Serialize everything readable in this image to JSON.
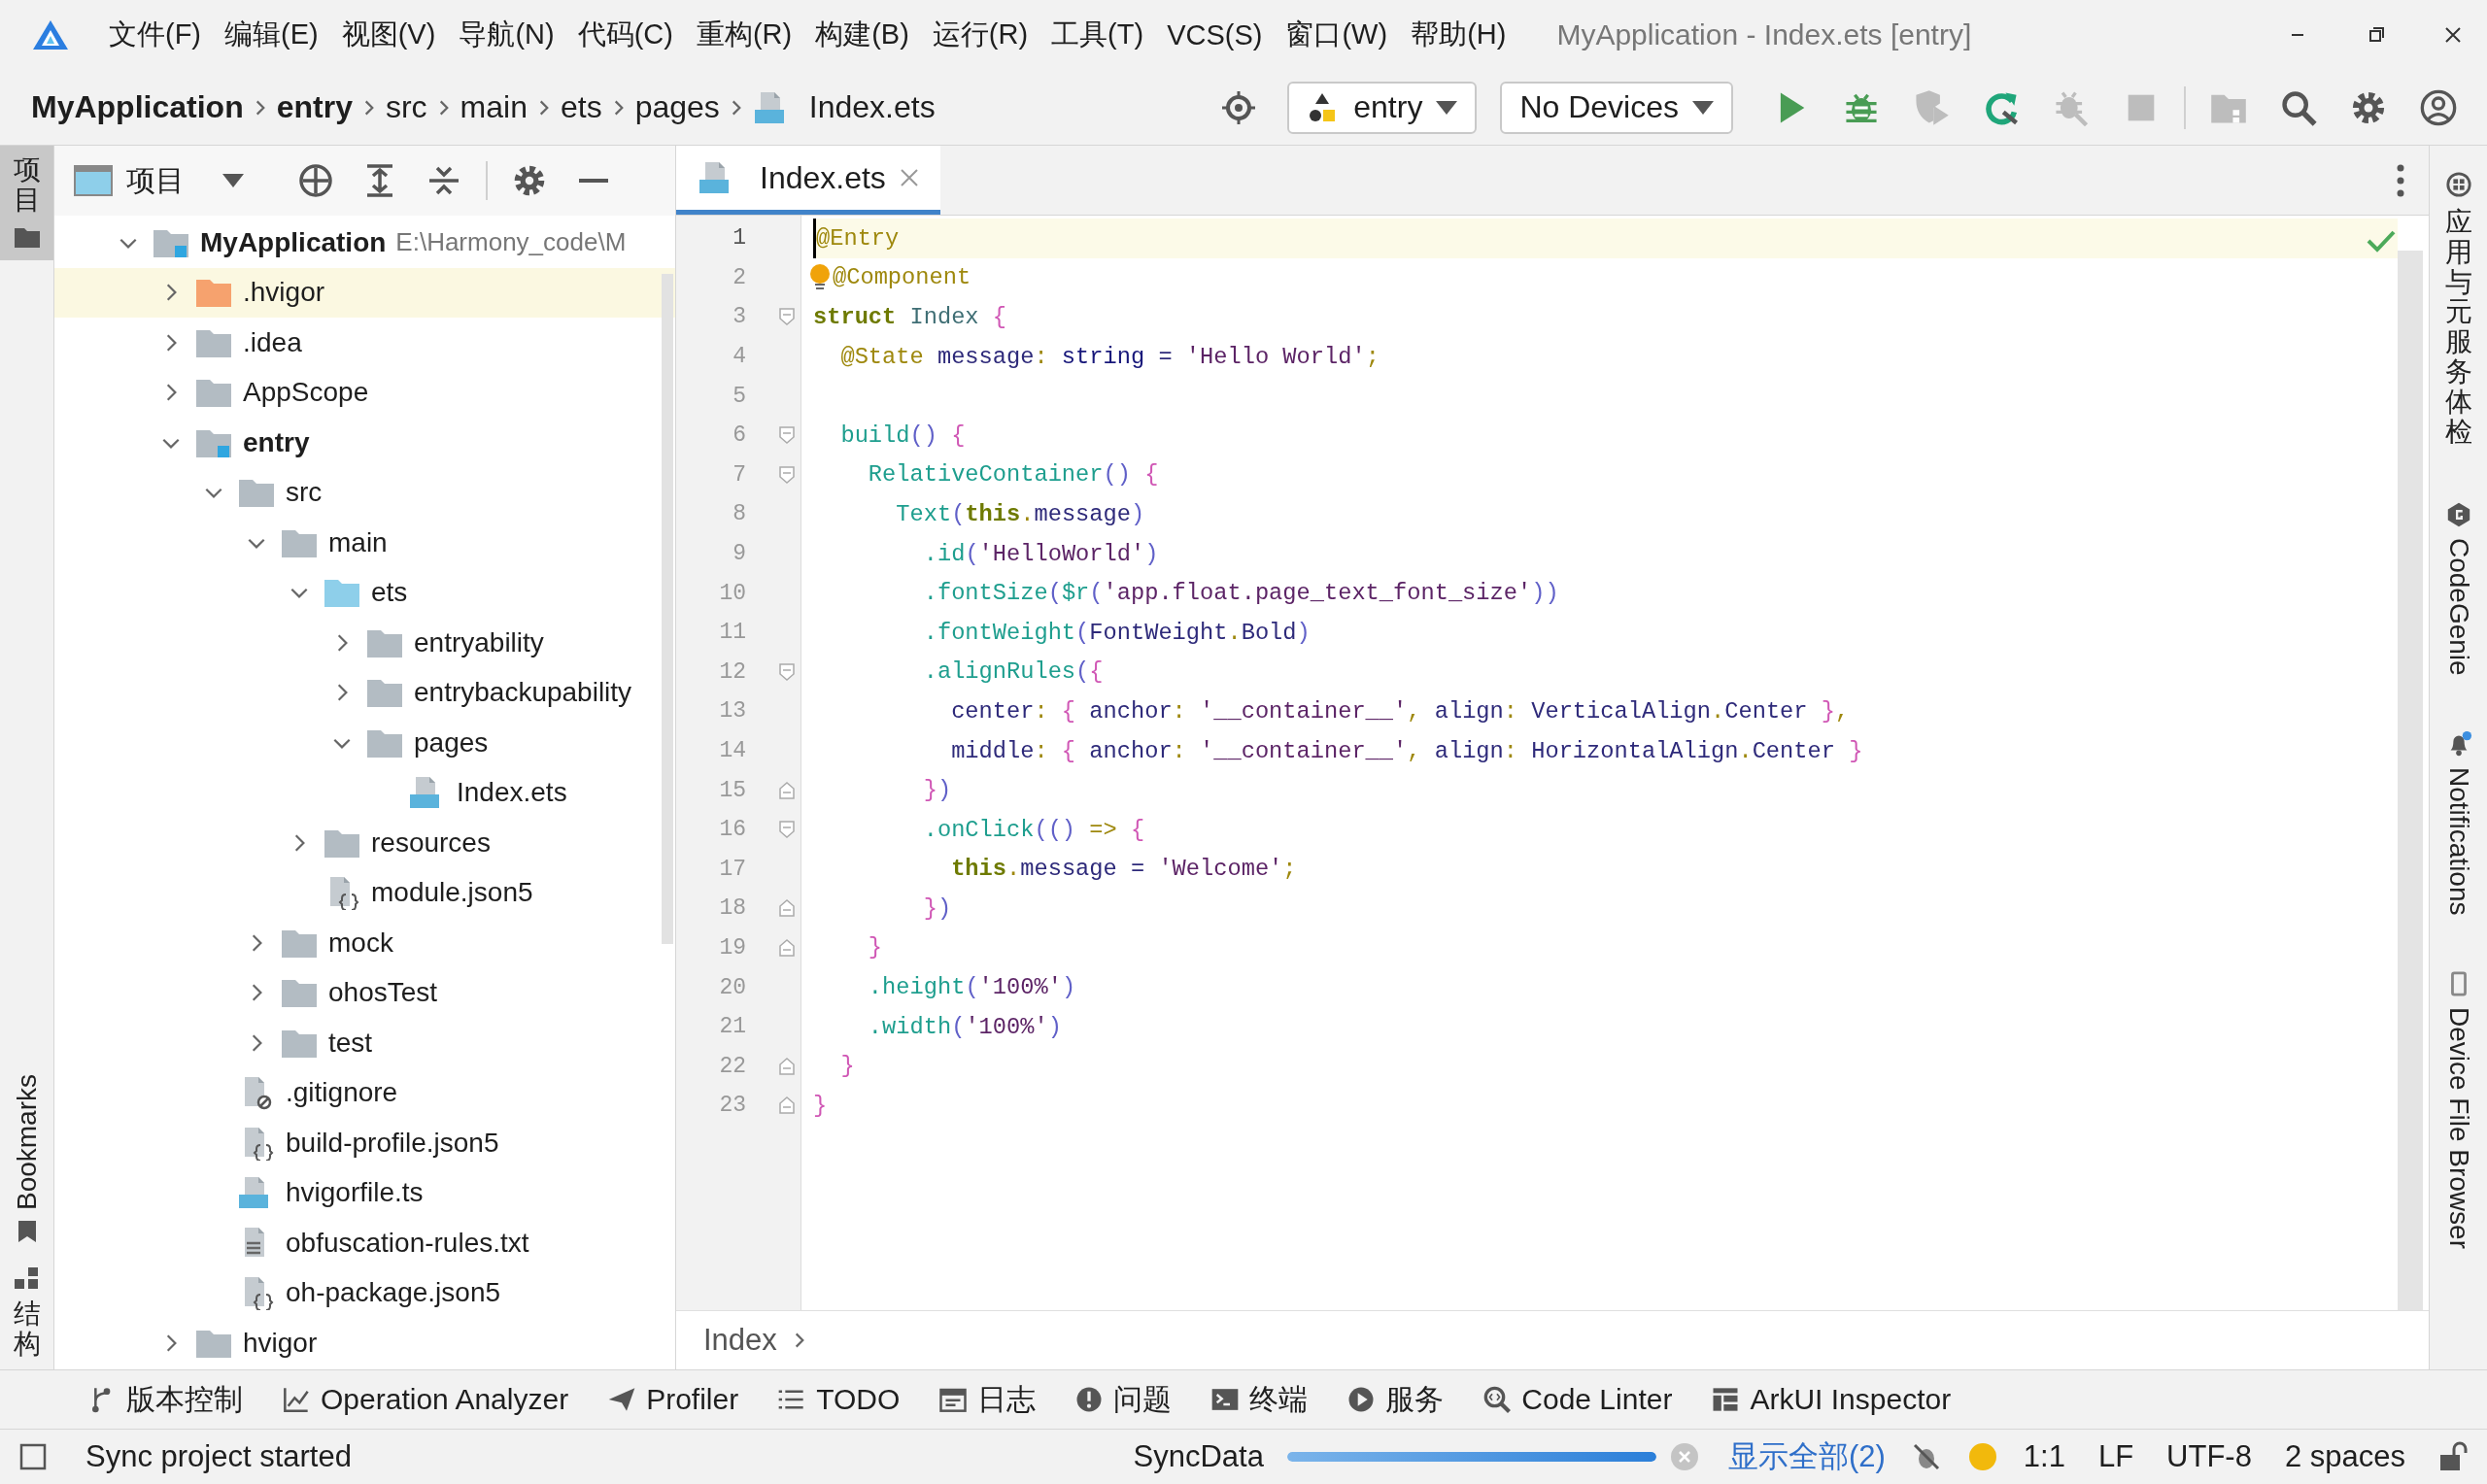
{
  "window": {
    "title": "MyApplication - Index.ets [entry]"
  },
  "menu": [
    "文件(F)",
    "编辑(E)",
    "视图(V)",
    "导航(N)",
    "代码(C)",
    "重构(R)",
    "构建(B)",
    "运行(R)",
    "工具(T)",
    "VCS(S)",
    "窗口(W)",
    "帮助(H)"
  ],
  "breadcrumb": [
    {
      "label": "MyApplication",
      "bold": true,
      "kind": "folder"
    },
    {
      "label": "entry",
      "bold": true,
      "kind": "folder"
    },
    {
      "label": "src",
      "bold": false,
      "kind": "folder"
    },
    {
      "label": "main",
      "bold": false,
      "kind": "folder"
    },
    {
      "label": "ets",
      "bold": false,
      "kind": "folder"
    },
    {
      "label": "pages",
      "bold": false,
      "kind": "folder"
    },
    {
      "label": "Index.ets",
      "bold": false,
      "kind": "ets-file"
    }
  ],
  "run_config": {
    "label": "entry"
  },
  "device": {
    "label": "No Devices"
  },
  "toolbar": [
    {
      "kind": "run",
      "disabled": false
    },
    {
      "kind": "debug",
      "disabled": false
    },
    {
      "kind": "profile",
      "disabled": true
    },
    {
      "kind": "apply",
      "disabled": false
    },
    {
      "kind": "attach",
      "disabled": true
    },
    {
      "kind": "stop",
      "disabled": true
    },
    {
      "kind": "divider"
    },
    {
      "kind": "device-manager",
      "disabled": true
    },
    {
      "kind": "search",
      "disabled": false
    },
    {
      "kind": "settings",
      "disabled": false
    },
    {
      "kind": "account",
      "disabled": false
    }
  ],
  "left_tabs": [
    {
      "label": "项目",
      "kind": "project",
      "selected": true
    },
    {
      "label": "Bookmarks",
      "kind": "bookmarks",
      "selected": false
    },
    {
      "label": "结构",
      "kind": "structure",
      "selected": false
    }
  ],
  "project_panel": {
    "view": "项目",
    "tree": [
      {
        "label": "MyApplication",
        "path": "E:\\Harmony_code\\M",
        "kind": "module",
        "bold": true,
        "highlighted": false,
        "expanded": true,
        "children": [
          {
            "label": ".hvigor",
            "kind": "excluded",
            "bold": false,
            "highlighted": true,
            "expanded": false
          },
          {
            "label": ".idea",
            "kind": "folder",
            "bold": false,
            "highlighted": false,
            "expanded": false
          },
          {
            "label": "AppScope",
            "kind": "folder",
            "bold": false,
            "highlighted": false,
            "expanded": false
          },
          {
            "label": "entry",
            "kind": "module",
            "bold": true,
            "highlighted": false,
            "expanded": true,
            "children": [
              {
                "label": "src",
                "kind": "folder",
                "bold": false,
                "highlighted": false,
                "expanded": true,
                "children": [
                  {
                    "label": "main",
                    "kind": "folder",
                    "bold": false,
                    "highlighted": false,
                    "expanded": true,
                    "children": [
                      {
                        "label": "ets",
                        "kind": "source",
                        "bold": false,
                        "highlighted": false,
                        "expanded": true,
                        "children": [
                          {
                            "label": "entryability",
                            "kind": "folder",
                            "bold": false,
                            "highlighted": false,
                            "expanded": false
                          },
                          {
                            "label": "entrybackupability",
                            "kind": "folder",
                            "bold": false,
                            "highlighted": false,
                            "expanded": false
                          },
                          {
                            "label": "pages",
                            "kind": "folder",
                            "bold": false,
                            "highlighted": false,
                            "expanded": true,
                            "children": [
                              {
                                "label": "Index.ets",
                                "kind": "ets-file",
                                "bold": false,
                                "highlighted": false
                              }
                            ]
                          }
                        ]
                      },
                      {
                        "label": "resources",
                        "kind": "folder",
                        "bold": false,
                        "highlighted": false,
                        "expanded": false
                      },
                      {
                        "label": "module.json5",
                        "kind": "json-file",
                        "bold": false,
                        "highlighted": false
                      }
                    ]
                  },
                  {
                    "label": "mock",
                    "kind": "folder",
                    "bold": false,
                    "highlighted": false,
                    "expanded": false
                  },
                  {
                    "label": "ohosTest",
                    "kind": "folder",
                    "bold": false,
                    "highlighted": false,
                    "expanded": false
                  },
                  {
                    "label": "test",
                    "kind": "folder",
                    "bold": false,
                    "highlighted": false,
                    "expanded": false
                  }
                ]
              },
              {
                "label": ".gitignore",
                "kind": "ignore-file",
                "bold": false,
                "highlighted": false
              },
              {
                "label": "build-profile.json5",
                "kind": "json-file",
                "bold": false,
                "highlighted": false
              },
              {
                "label": "hvigorfile.ts",
                "kind": "ts-file",
                "bold": false,
                "highlighted": false
              },
              {
                "label": "obfuscation-rules.txt",
                "kind": "text-file",
                "bold": false,
                "highlighted": false
              },
              {
                "label": "oh-package.json5",
                "kind": "json-file",
                "bold": false,
                "highlighted": false
              }
            ]
          },
          {
            "label": "hvigor",
            "kind": "folder",
            "bold": false,
            "highlighted": false,
            "expanded": false
          }
        ]
      }
    ]
  },
  "editor": {
    "tabs": [
      {
        "label": "Index.ets",
        "selected": true
      }
    ],
    "lines": [
      {
        "number": "1",
        "current": true,
        "intention": false,
        "fold_start": false,
        "fold_end": false,
        "tokens": [
          {
            "text": "@Entry",
            "kind": "annotation"
          }
        ]
      },
      {
        "number": "2",
        "current": false,
        "intention": true,
        "fold_start": false,
        "fold_end": false,
        "tokens": [
          {
            "text": "@Component",
            "kind": "annotation"
          }
        ]
      },
      {
        "number": "3",
        "current": false,
        "intention": false,
        "fold_start": true,
        "fold_end": false,
        "tokens": [
          {
            "text": "struct",
            "kind": "keyword"
          },
          {
            "text": " Index",
            "kind": "name"
          },
          {
            "text": " {",
            "kind": "brace"
          }
        ]
      },
      {
        "number": "4",
        "current": false,
        "intention": false,
        "fold_start": false,
        "fold_end": false,
        "tokens": [
          {
            "text": "  @State",
            "kind": "annotation"
          },
          {
            "text": " message",
            "kind": "property"
          },
          {
            "text": ":",
            "kind": "punct"
          },
          {
            "text": " string",
            "kind": "type"
          },
          {
            "text": " =",
            "kind": "op"
          },
          {
            "text": " 'Hello World'",
            "kind": "string"
          },
          {
            "text": ";",
            "kind": "punct"
          }
        ]
      },
      {
        "number": "5",
        "current": false,
        "intention": false,
        "fold_start": false,
        "fold_end": false
      },
      {
        "number": "6",
        "current": false,
        "intention": false,
        "fold_start": true,
        "fold_end": false,
        "tokens": [
          {
            "text": "  build",
            "kind": "func"
          },
          {
            "text": "()",
            "kind": "paren"
          },
          {
            "text": " {",
            "kind": "brace"
          }
        ]
      },
      {
        "number": "7",
        "current": false,
        "intention": false,
        "fold_start": true,
        "fold_end": false,
        "tokens": [
          {
            "text": "    RelativeContainer",
            "kind": "func"
          },
          {
            "text": "()",
            "kind": "paren"
          },
          {
            "text": " {",
            "kind": "brace"
          }
        ]
      },
      {
        "number": "8",
        "current": false,
        "intention": false,
        "fold_start": false,
        "fold_end": false,
        "tokens": [
          {
            "text": "      Text",
            "kind": "func"
          },
          {
            "text": "(",
            "kind": "paren"
          },
          {
            "text": "this",
            "kind": "keyword"
          },
          {
            "text": ".",
            "kind": "punct"
          },
          {
            "text": "message",
            "kind": "property"
          },
          {
            "text": ")",
            "kind": "paren"
          }
        ]
      },
      {
        "number": "9",
        "current": false,
        "intention": false,
        "fold_start": false,
        "fold_end": false,
        "tokens": [
          {
            "text": "        .id",
            "kind": "func"
          },
          {
            "text": "(",
            "kind": "paren"
          },
          {
            "text": "'HelloWorld'",
            "kind": "string"
          },
          {
            "text": ")",
            "kind": "paren"
          }
        ]
      },
      {
        "number": "10",
        "current": false,
        "intention": false,
        "fold_start": false,
        "fold_end": false,
        "tokens": [
          {
            "text": "        .fontSize",
            "kind": "func"
          },
          {
            "text": "(",
            "kind": "paren"
          },
          {
            "text": "$r",
            "kind": "func"
          },
          {
            "text": "(",
            "kind": "paren"
          },
          {
            "text": "'app.float.page_text_font_size'",
            "kind": "string"
          },
          {
            "text": "))",
            "kind": "paren"
          }
        ]
      },
      {
        "number": "11",
        "current": false,
        "intention": false,
        "fold_start": false,
        "fold_end": false,
        "tokens": [
          {
            "text": "        .fontWeight",
            "kind": "func"
          },
          {
            "text": "(",
            "kind": "paren"
          },
          {
            "text": "FontWeight",
            "kind": "property"
          },
          {
            "text": ".",
            "kind": "punct"
          },
          {
            "text": "Bold",
            "kind": "property"
          },
          {
            "text": ")",
            "kind": "paren"
          }
        ]
      },
      {
        "number": "12",
        "current": false,
        "intention": false,
        "fold_start": true,
        "fold_end": false,
        "tokens": [
          {
            "text": "        .alignRules",
            "kind": "func"
          },
          {
            "text": "(",
            "kind": "paren"
          },
          {
            "text": "{",
            "kind": "brace"
          }
        ]
      },
      {
        "number": "13",
        "current": false,
        "intention": false,
        "fold_start": false,
        "fold_end": false,
        "tokens": [
          {
            "text": "          center",
            "kind": "property"
          },
          {
            "text": ":",
            "kind": "punct"
          },
          {
            "text": " {",
            "kind": "brace"
          },
          {
            "text": " anchor",
            "kind": "property"
          },
          {
            "text": ":",
            "kind": "punct"
          },
          {
            "text": " '__container__'",
            "kind": "string"
          },
          {
            "text": ",",
            "kind": "punct"
          },
          {
            "text": " align",
            "kind": "property"
          },
          {
            "text": ":",
            "kind": "punct"
          },
          {
            "text": " VerticalAlign",
            "kind": "property"
          },
          {
            "text": ".",
            "kind": "punct"
          },
          {
            "text": "Center",
            "kind": "property"
          },
          {
            "text": " }",
            "kind": "brace"
          },
          {
            "text": ",",
            "kind": "punct"
          }
        ]
      },
      {
        "number": "14",
        "current": false,
        "intention": false,
        "fold_start": false,
        "fold_end": false,
        "tokens": [
          {
            "text": "          middle",
            "kind": "property"
          },
          {
            "text": ":",
            "kind": "punct"
          },
          {
            "text": " {",
            "kind": "brace"
          },
          {
            "text": " anchor",
            "kind": "property"
          },
          {
            "text": ":",
            "kind": "punct"
          },
          {
            "text": " '__container__'",
            "kind": "string"
          },
          {
            "text": ",",
            "kind": "punct"
          },
          {
            "text": " align",
            "kind": "property"
          },
          {
            "text": ":",
            "kind": "punct"
          },
          {
            "text": " HorizontalAlign",
            "kind": "property"
          },
          {
            "text": ".",
            "kind": "punct"
          },
          {
            "text": "Center",
            "kind": "property"
          },
          {
            "text": " }",
            "kind": "brace"
          }
        ]
      },
      {
        "number": "15",
        "current": false,
        "intention": false,
        "fold_start": false,
        "fold_end": true,
        "tokens": [
          {
            "text": "        }",
            "kind": "brace"
          },
          {
            "text": ")",
            "kind": "paren"
          }
        ]
      },
      {
        "number": "16",
        "current": false,
        "intention": false,
        "fold_start": true,
        "fold_end": false,
        "tokens": [
          {
            "text": "        .onClick",
            "kind": "func"
          },
          {
            "text": "(()",
            "kind": "paren"
          },
          {
            "text": " =>",
            "kind": "punct"
          },
          {
            "text": " {",
            "kind": "brace"
          }
        ]
      },
      {
        "number": "17",
        "current": false,
        "intention": false,
        "fold_start": false,
        "fold_end": false,
        "tokens": [
          {
            "text": "          this",
            "kind": "keyword"
          },
          {
            "text": ".",
            "kind": "punct"
          },
          {
            "text": "message",
            "kind": "property"
          },
          {
            "text": " =",
            "kind": "op"
          },
          {
            "text": " 'Welcome'",
            "kind": "string"
          },
          {
            "text": ";",
            "kind": "punct"
          }
        ]
      },
      {
        "number": "18",
        "current": false,
        "intention": false,
        "fold_start": false,
        "fold_end": true,
        "tokens": [
          {
            "text": "        }",
            "kind": "brace"
          },
          {
            "text": ")",
            "kind": "paren"
          }
        ]
      },
      {
        "number": "19",
        "current": false,
        "intention": false,
        "fold_start": false,
        "fold_end": true,
        "tokens": [
          {
            "text": "    }",
            "kind": "brace"
          }
        ]
      },
      {
        "number": "20",
        "current": false,
        "intention": false,
        "fold_start": false,
        "fold_end": false,
        "tokens": [
          {
            "text": "    .height",
            "kind": "func"
          },
          {
            "text": "(",
            "kind": "paren"
          },
          {
            "text": "'100%'",
            "kind": "string"
          },
          {
            "text": ")",
            "kind": "paren"
          }
        ]
      },
      {
        "number": "21",
        "current": false,
        "intention": false,
        "fold_start": false,
        "fold_end": false,
        "tokens": [
          {
            "text": "    .width",
            "kind": "func"
          },
          {
            "text": "(",
            "kind": "paren"
          },
          {
            "text": "'100%'",
            "kind": "string"
          },
          {
            "text": ")",
            "kind": "paren"
          }
        ]
      },
      {
        "number": "22",
        "current": false,
        "intention": false,
        "fold_start": false,
        "fold_end": true,
        "tokens": [
          {
            "text": "  }",
            "kind": "brace"
          }
        ]
      },
      {
        "number": "23",
        "current": false,
        "intention": false,
        "fold_start": false,
        "fold_end": true,
        "tokens": [
          {
            "text": "}",
            "kind": "brace"
          }
        ]
      }
    ],
    "breadcrumb": [
      "Index"
    ]
  },
  "right_tabs": [
    {
      "label": "应用与元服务体检",
      "kind": "check"
    },
    {
      "label": "CodeGenie",
      "kind": "genie"
    },
    {
      "label": "Notifications",
      "kind": "notifications"
    },
    {
      "label": "Device File Browser",
      "kind": "device"
    }
  ],
  "tool_windows": [
    {
      "label": "版本控制",
      "kind": "vcs"
    },
    {
      "label": "Operation Analyzer",
      "kind": "analyzer"
    },
    {
      "label": "Profiler",
      "kind": "profiler"
    },
    {
      "label": "TODO",
      "kind": "todo"
    },
    {
      "label": "日志",
      "kind": "log"
    },
    {
      "label": "问题",
      "kind": "problems"
    },
    {
      "label": "终端",
      "kind": "terminal"
    },
    {
      "label": "服务",
      "kind": "services"
    },
    {
      "label": "Code Linter",
      "kind": "linter"
    },
    {
      "label": "ArkUI Inspector",
      "kind": "inspector"
    }
  ],
  "status": {
    "message": "Sync project started",
    "task": "SyncData",
    "level": 1,
    "show_all": "显示全部(2)",
    "position": "1:1",
    "line_ending": "LF",
    "encoding": "UTF-8",
    "indent": "2 spaces"
  }
}
